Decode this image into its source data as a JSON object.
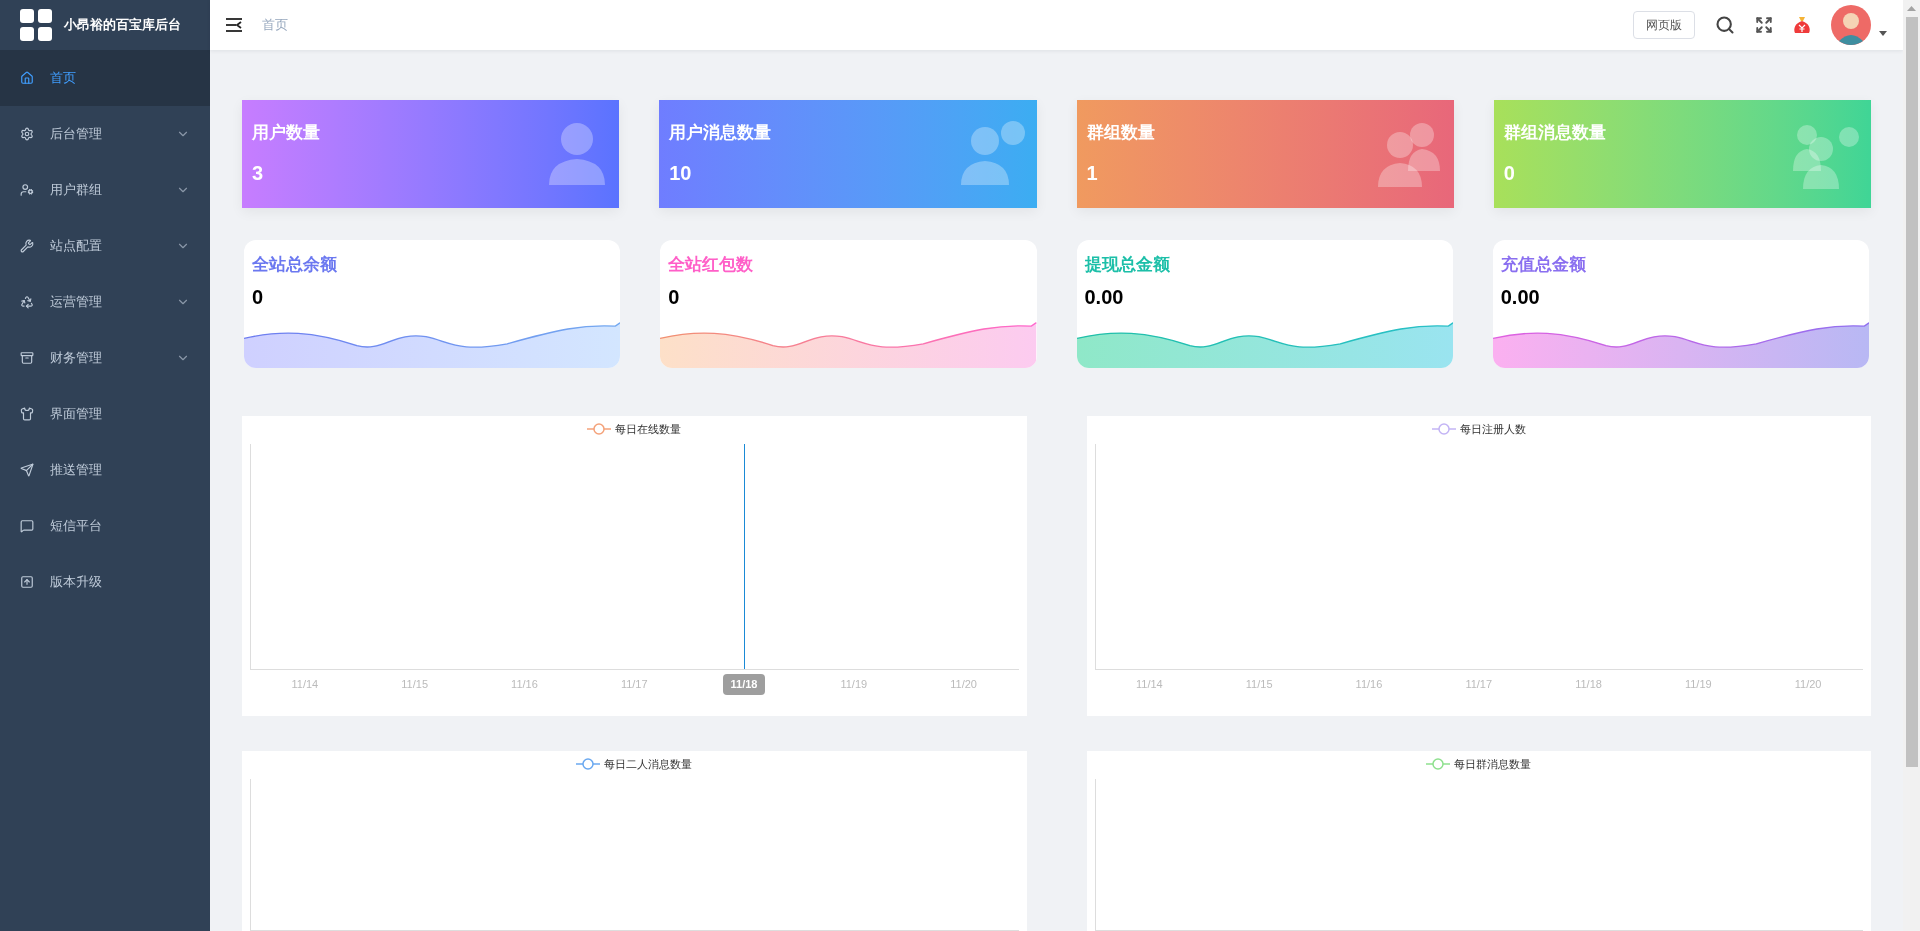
{
  "sidebar": {
    "title": "小昂裕的百宝库后台",
    "items": [
      {
        "label": "首页",
        "selected": true,
        "has_submenu": false
      },
      {
        "label": "后台管理",
        "selected": false,
        "has_submenu": true
      },
      {
        "label": "用户群组",
        "selected": false,
        "has_submenu": true
      },
      {
        "label": "站点配置",
        "selected": false,
        "has_submenu": true
      },
      {
        "label": "运营管理",
        "selected": false,
        "has_submenu": true
      },
      {
        "label": "财务管理",
        "selected": false,
        "has_submenu": true
      },
      {
        "label": "界面管理",
        "selected": false,
        "has_submenu": false
      },
      {
        "label": "推送管理",
        "selected": false,
        "has_submenu": false
      },
      {
        "label": "短信平台",
        "selected": false,
        "has_submenu": false
      },
      {
        "label": "版本升级",
        "selected": false,
        "has_submenu": false
      }
    ]
  },
  "header": {
    "breadcrumb": "首页",
    "web_button": "网页版"
  },
  "stat_cards": [
    {
      "label": "用户数量",
      "value": "3"
    },
    {
      "label": "用户消息数量",
      "value": "10"
    },
    {
      "label": "群组数量",
      "value": "1"
    },
    {
      "label": "群组消息数量",
      "value": "0"
    }
  ],
  "wave_cards": [
    {
      "label": "全站总余额",
      "value": "0"
    },
    {
      "label": "全站红包数",
      "value": "0"
    },
    {
      "label": "提现总金额",
      "value": "0.00"
    },
    {
      "label": "充值总金额",
      "value": "0.00"
    }
  ],
  "charts": [
    {
      "legend": "每日在线数量",
      "color": "#f4a27a",
      "x_labels": [
        {
          "label": "11/14",
          "selected": false
        },
        {
          "label": "11/15",
          "selected": false
        },
        {
          "label": "11/16",
          "selected": false
        },
        {
          "label": "11/17",
          "selected": false
        },
        {
          "label": "11/18",
          "selected": true
        },
        {
          "label": "11/19",
          "selected": false
        },
        {
          "label": "11/20",
          "selected": false
        }
      ]
    },
    {
      "legend": "每日注册人数",
      "color": "#c3b4f5",
      "x_labels": [
        {
          "label": "11/14",
          "selected": false
        },
        {
          "label": "11/15",
          "selected": false
        },
        {
          "label": "11/16",
          "selected": false
        },
        {
          "label": "11/17",
          "selected": false
        },
        {
          "label": "11/18",
          "selected": false
        },
        {
          "label": "11/19",
          "selected": false
        },
        {
          "label": "11/20",
          "selected": false
        }
      ]
    },
    {
      "legend": "每日二人消息数量",
      "color": "#6aa8f0"
    },
    {
      "legend": "每日群消息数量",
      "color": "#8ee08e"
    }
  ]
}
